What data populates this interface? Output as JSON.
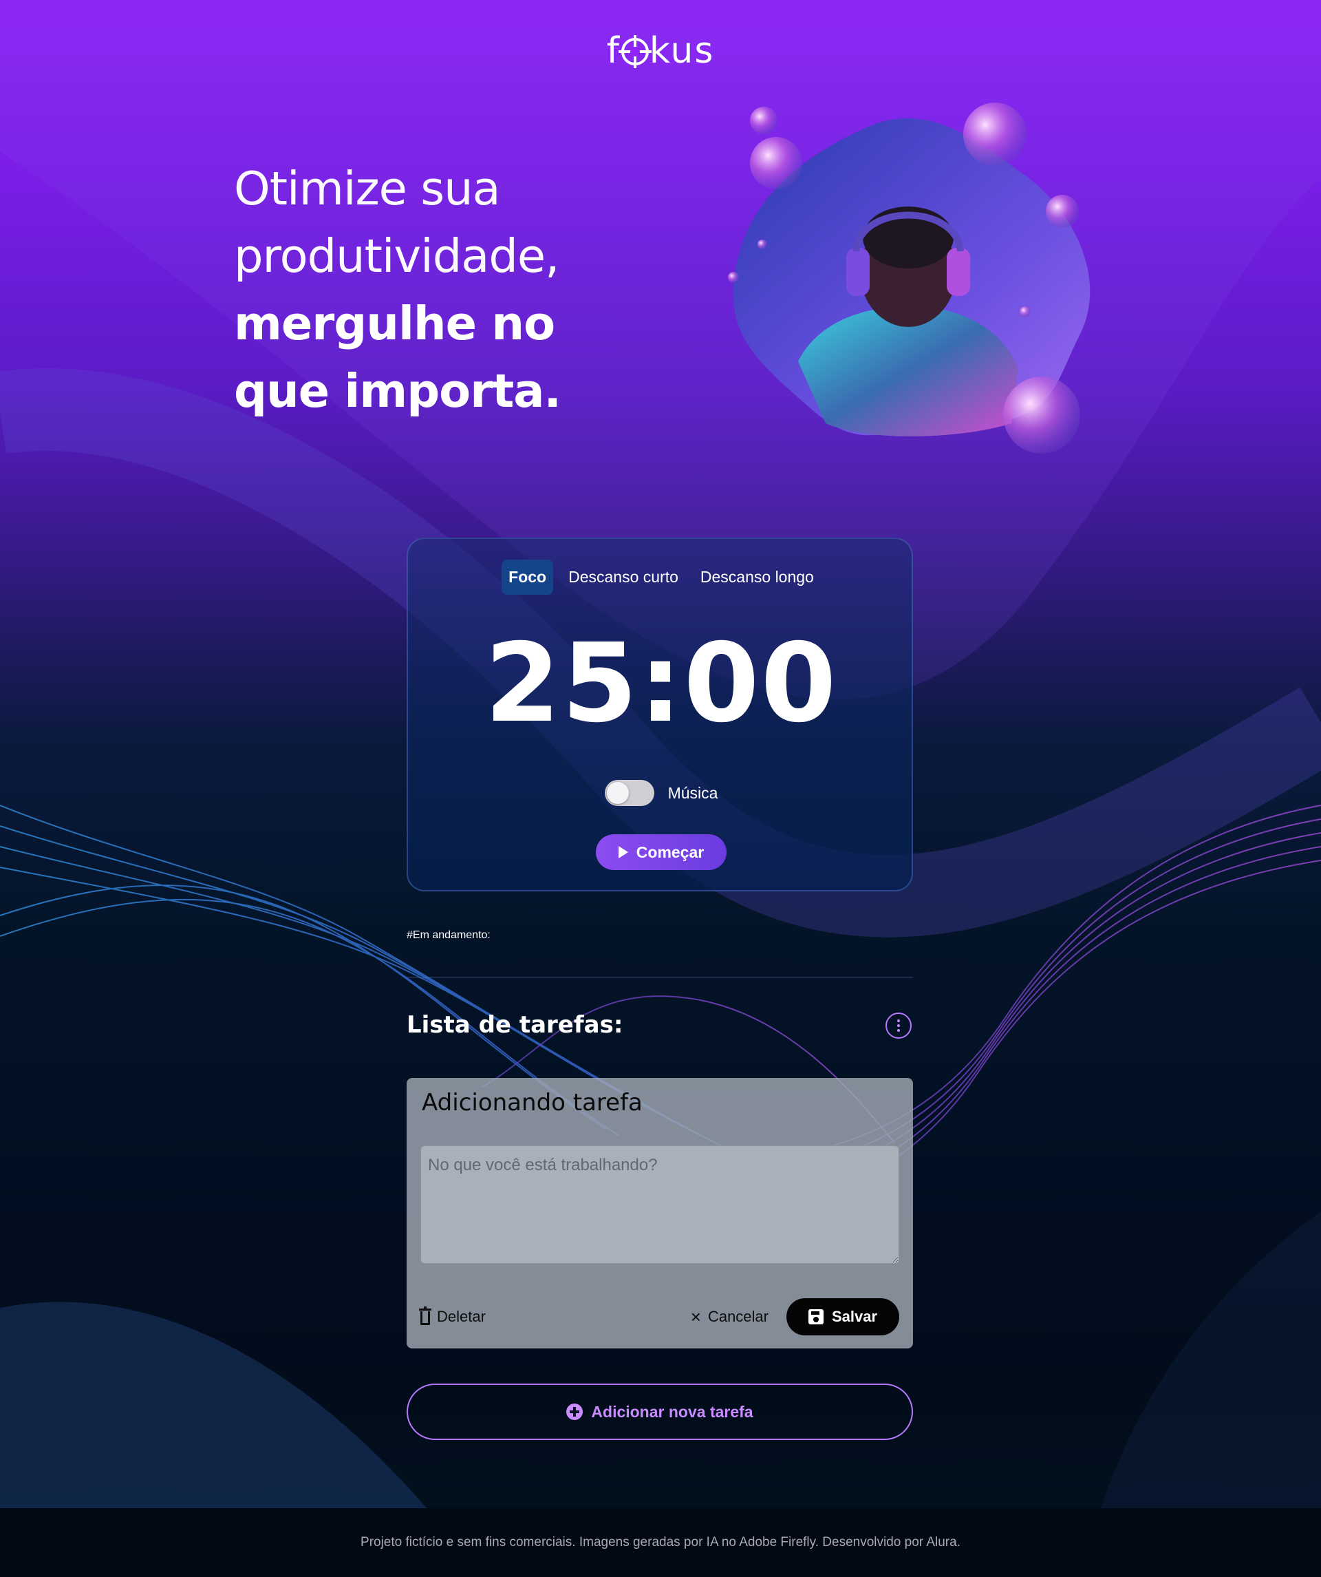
{
  "brand": {
    "logo_prefix": "f",
    "logo_suffix": "kus",
    "accent": "#9122f8"
  },
  "hero": {
    "line1": "Otimize sua",
    "line2": "produtividade,",
    "line3": "mergulhe no",
    "line4": "que importa.",
    "image_icon": "headphones-person-illustration"
  },
  "timer_card": {
    "tabs": [
      {
        "label": "Foco",
        "active": true
      },
      {
        "label": "Descanso curto",
        "active": false
      },
      {
        "label": "Descanso longo",
        "active": false
      }
    ],
    "time": "25:00",
    "music_label": "Música",
    "music_on": false,
    "start_label": "Começar"
  },
  "in_progress_label": "#Em andamento:",
  "task_list": {
    "title": "Lista de tarefas:",
    "form": {
      "title": "Adicionando tarefa",
      "placeholder": "No que você está trabalhando?",
      "delete_label": "Deletar",
      "cancel_label": "Cancelar",
      "save_label": "Salvar"
    },
    "add_label": "Adicionar nova tarefa"
  },
  "footer": {
    "text": "Projeto fictício e sem fins comerciais. Imagens geradas por IA no Adobe Firefly. Desenvolvido por Alura."
  }
}
